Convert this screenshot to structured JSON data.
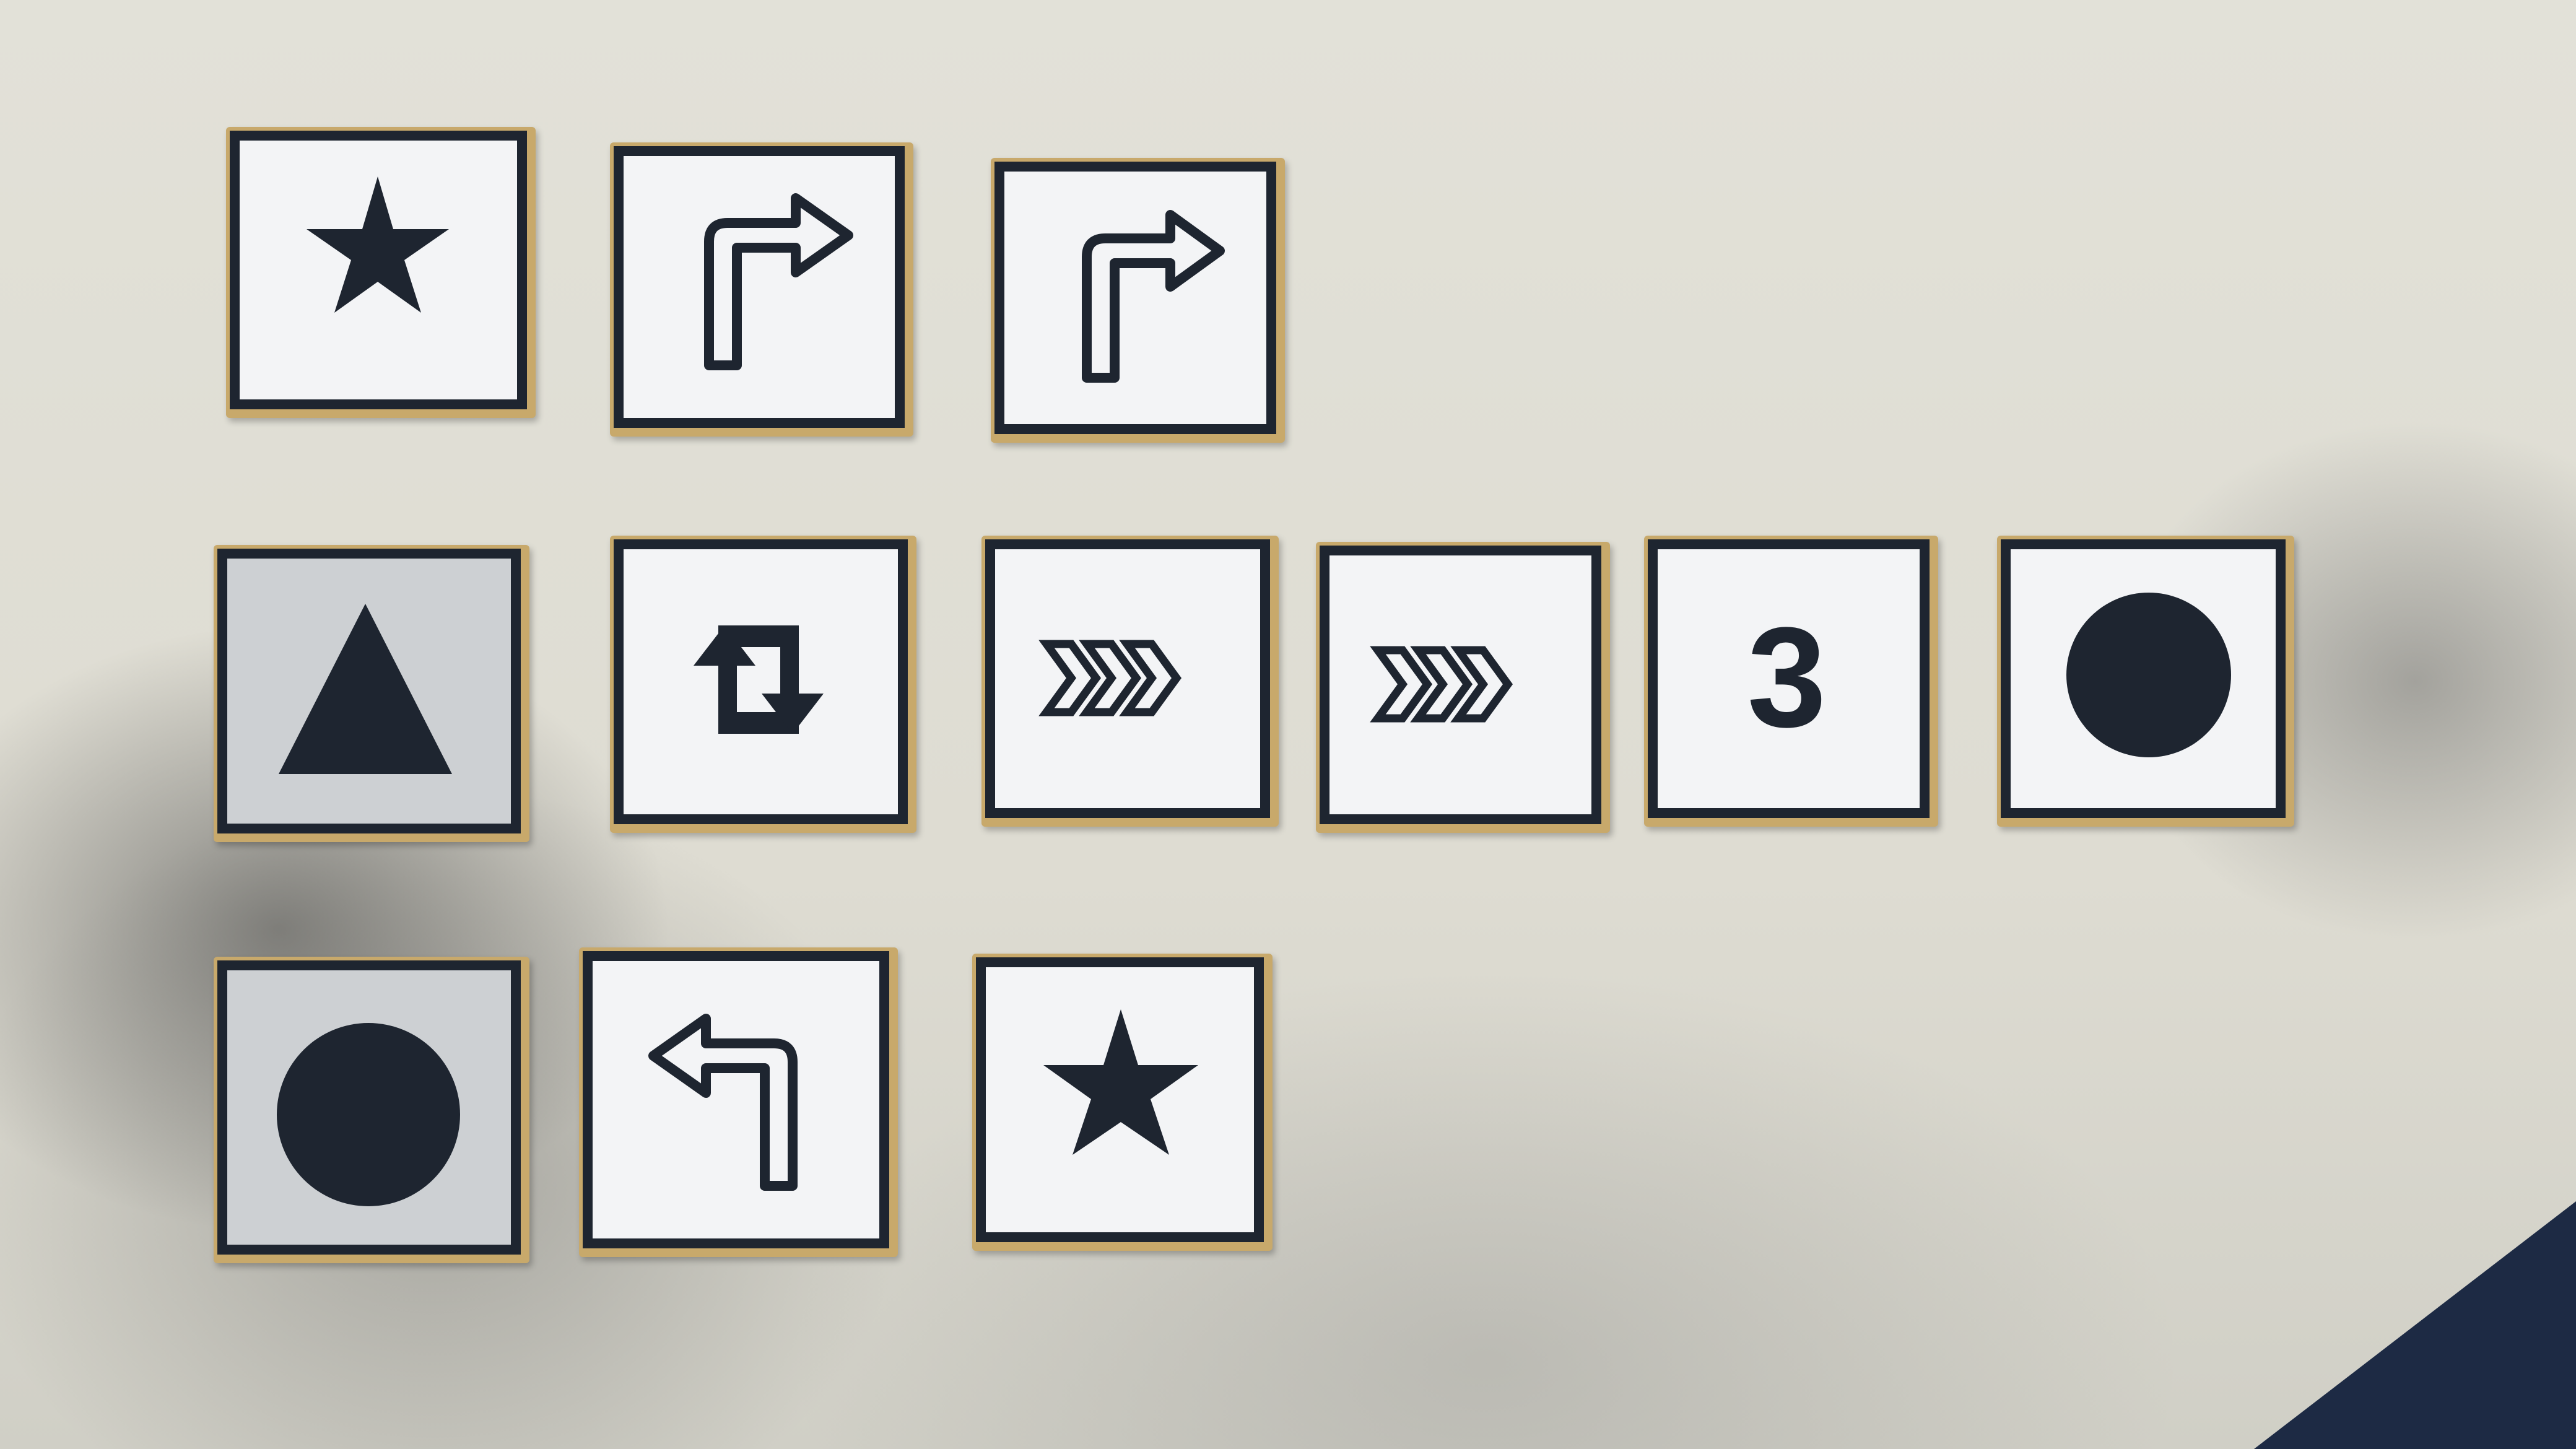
{
  "scene": {
    "description_colors": {
      "surface": "#e6e5dc",
      "tile_border": "#1e2530",
      "tile_face": "#f3f4f6",
      "tile_wood": "#c8a96b",
      "corner_object": "#1d2a44"
    }
  },
  "tiles": {
    "row1": [
      {
        "icon": "star-icon"
      },
      {
        "icon": "turn-right-arrow-icon"
      },
      {
        "icon": "turn-right-arrow-icon"
      }
    ],
    "row2": [
      {
        "icon": "triangle-icon"
      },
      {
        "icon": "repeat-loop-icon"
      },
      {
        "icon": "fast-forward-chevrons-icon"
      },
      {
        "icon": "fast-forward-chevrons-icon"
      },
      {
        "icon": "number-icon",
        "text": "3"
      },
      {
        "icon": "circle-icon"
      }
    ],
    "row3": [
      {
        "icon": "circle-icon"
      },
      {
        "icon": "turn-left-arrow-icon"
      },
      {
        "icon": "star-icon"
      }
    ]
  }
}
